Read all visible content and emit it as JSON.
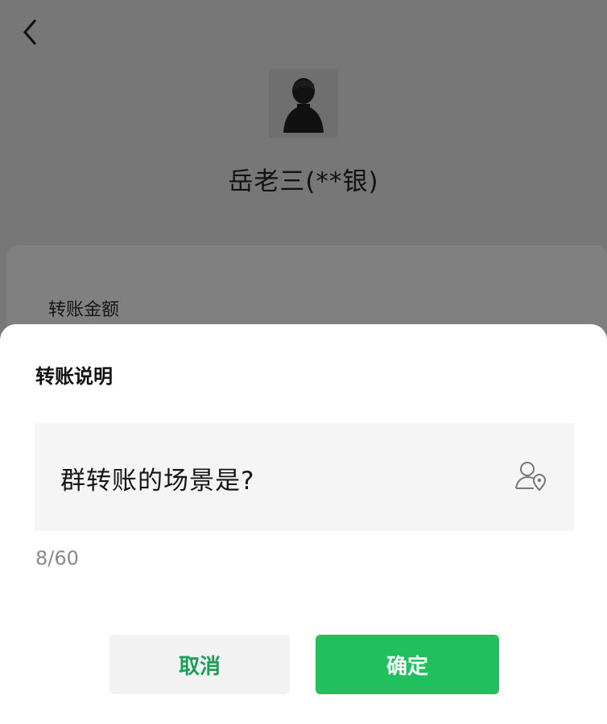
{
  "background": {
    "payee": {
      "name": "岳老三(**银)"
    },
    "amount_label": "转账金额"
  },
  "sheet": {
    "title": "转账说明",
    "note": {
      "value": "群转账的场景是?"
    },
    "char_count": "8/60",
    "cancel_label": "取消",
    "confirm_label": "确定"
  },
  "icons": {
    "back": "chevron-left-icon",
    "contact": "contact-location-icon"
  },
  "colors": {
    "accent_green": "#20c05c",
    "cancel_text_green": "#18a058",
    "overlay_gray": "#777777"
  }
}
